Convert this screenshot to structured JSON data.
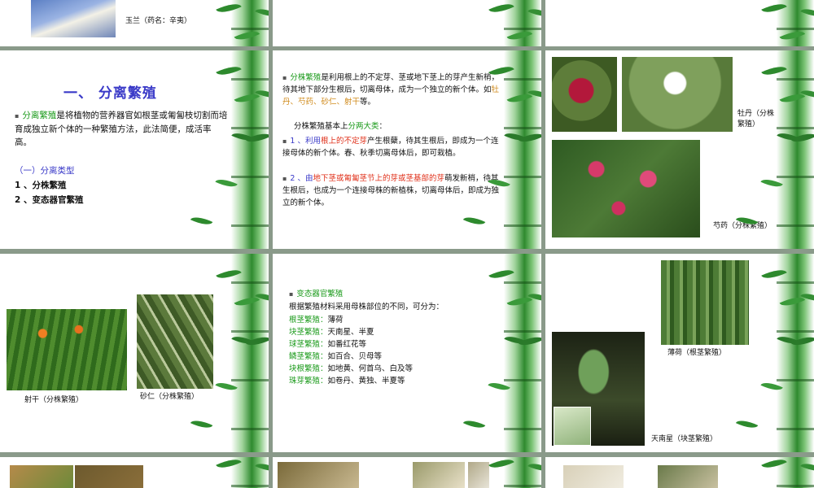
{
  "slide1": {
    "caption": "玉兰（药名：辛夷）"
  },
  "slide4": {
    "title": "一、 分离繁殖",
    "p1_term": "分离繁殖",
    "p1_rest": "是将植物的营养器官如根茎或匍匐枝切割而培育成独立新个体的一种繁殖方法，此法简便，成活率高。",
    "subtitle": "（一）分离类型",
    "item1": "1 、分株繁殖",
    "item2": "2 、变态器官繁殖"
  },
  "slide5": {
    "p1_term": "分株繁殖",
    "p1_mid": "是利用根上的不定芽、茎或地下茎上的芽产生新梢，待其地下部分生根后，切离母体，成为一个独立的新个体。如",
    "p1_examples": "牡丹、芍药、砂仁、射干",
    "p1_end": "等。",
    "p2_lead": "分株繁殖基本上",
    "p2_term": "分两大类",
    "p2_end": "：",
    "p3_num": "1 、利用",
    "p3_term": "根上的不定芽",
    "p3_rest": "产生根蘖，待其生根后，即成为一个连接母体的新个体。春、秋季切离母体后，即可栽植。",
    "p4_num": "2 、由",
    "p4_term": "地下茎或匍匐茎节上的芽或茎基部的芽",
    "p4_rest": "萌发新梢，待其生根后，也成为一个连接母株的新植株，切离母体后，即成为独立的新个体。"
  },
  "slide6": {
    "caption_mudan": "牡丹（分株繁殖）",
    "caption_shaoyao": "芍药（分株繁殖）"
  },
  "slide7": {
    "caption_shegan": "射干（分株繁殖）",
    "caption_sharen": "砂仁（分株繁殖）"
  },
  "slide8": {
    "title": "变态器官繁殖",
    "intro": "根据繁殖材料采用母株部位的不同，可分为：",
    "rows": [
      {
        "term": "根茎繁殖：",
        "examples": "薄荷"
      },
      {
        "term": "块茎繁殖：",
        "examples": "天南星、半夏"
      },
      {
        "term": "球茎繁殖：",
        "examples": "如番红花等"
      },
      {
        "term": "鳞茎繁殖：",
        "examples": "如百合、贝母等"
      },
      {
        "term": "块根繁殖：",
        "examples": "如地黄、何首乌、白及等"
      },
      {
        "term": "珠芽繁殖：",
        "examples": "如卷丹、黄独、半夏等"
      }
    ]
  },
  "slide9": {
    "caption_bohe": "薄荷（根茎繁殖）",
    "caption_tiannanxing": "天南星（块茎繁殖）"
  }
}
